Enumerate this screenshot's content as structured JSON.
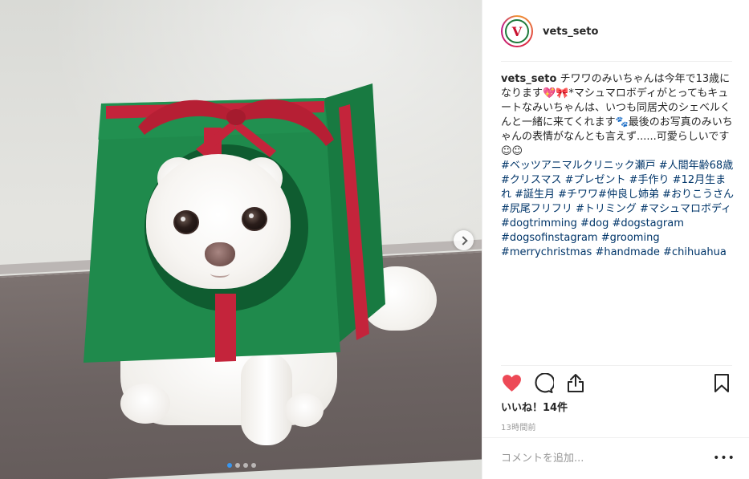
{
  "post": {
    "username": "vets_seto",
    "avatar_icon": "clinic-logo-icon",
    "avatar_letter": "V",
    "caption": {
      "user": "vets_seto",
      "text": " チワワのみいちゃんは今年で13歳になります💖🎀*マシュマロボディがとってもキュートなみいちゃんは、いつも同居犬のシェベルくんと一緒に来てくれます🐾最後のお写真のみいちゃんの表情がなんとも言えず......可愛らしいです☺☺",
      "hashtags_jp": "#ベッツアニマルクリニック瀬戸 #人間年齢68歳 #クリスマス #プレゼント #手作り #12月生まれ #誕生月 #チワワ#仲良し姉弟 #おりこうさん #尻尾フリフリ #トリミング #マシュマロボディ",
      "hashtags_en": [
        "#dogtrimming #dog #dogstagram",
        "#dogsofinstagram #grooming",
        "#merrychristmas #handmade #chihuahua"
      ]
    },
    "likes": "いいね！14件",
    "time": "13時間前",
    "comment_placeholder": "コメントを追加...",
    "more_options": "•••"
  },
  "icons": {
    "like": "heart-icon",
    "comment": "comment-icon",
    "share": "share-icon",
    "save": "bookmark-icon",
    "next": "chevron-right-icon"
  },
  "colors": {
    "like_active": "#ed4956",
    "hashtag": "#003569",
    "dot_active": "#3897f0",
    "gift_green": "#1f8a4c",
    "ribbon_red": "#c4243b"
  },
  "carousel": {
    "total": 4,
    "active": 1
  }
}
